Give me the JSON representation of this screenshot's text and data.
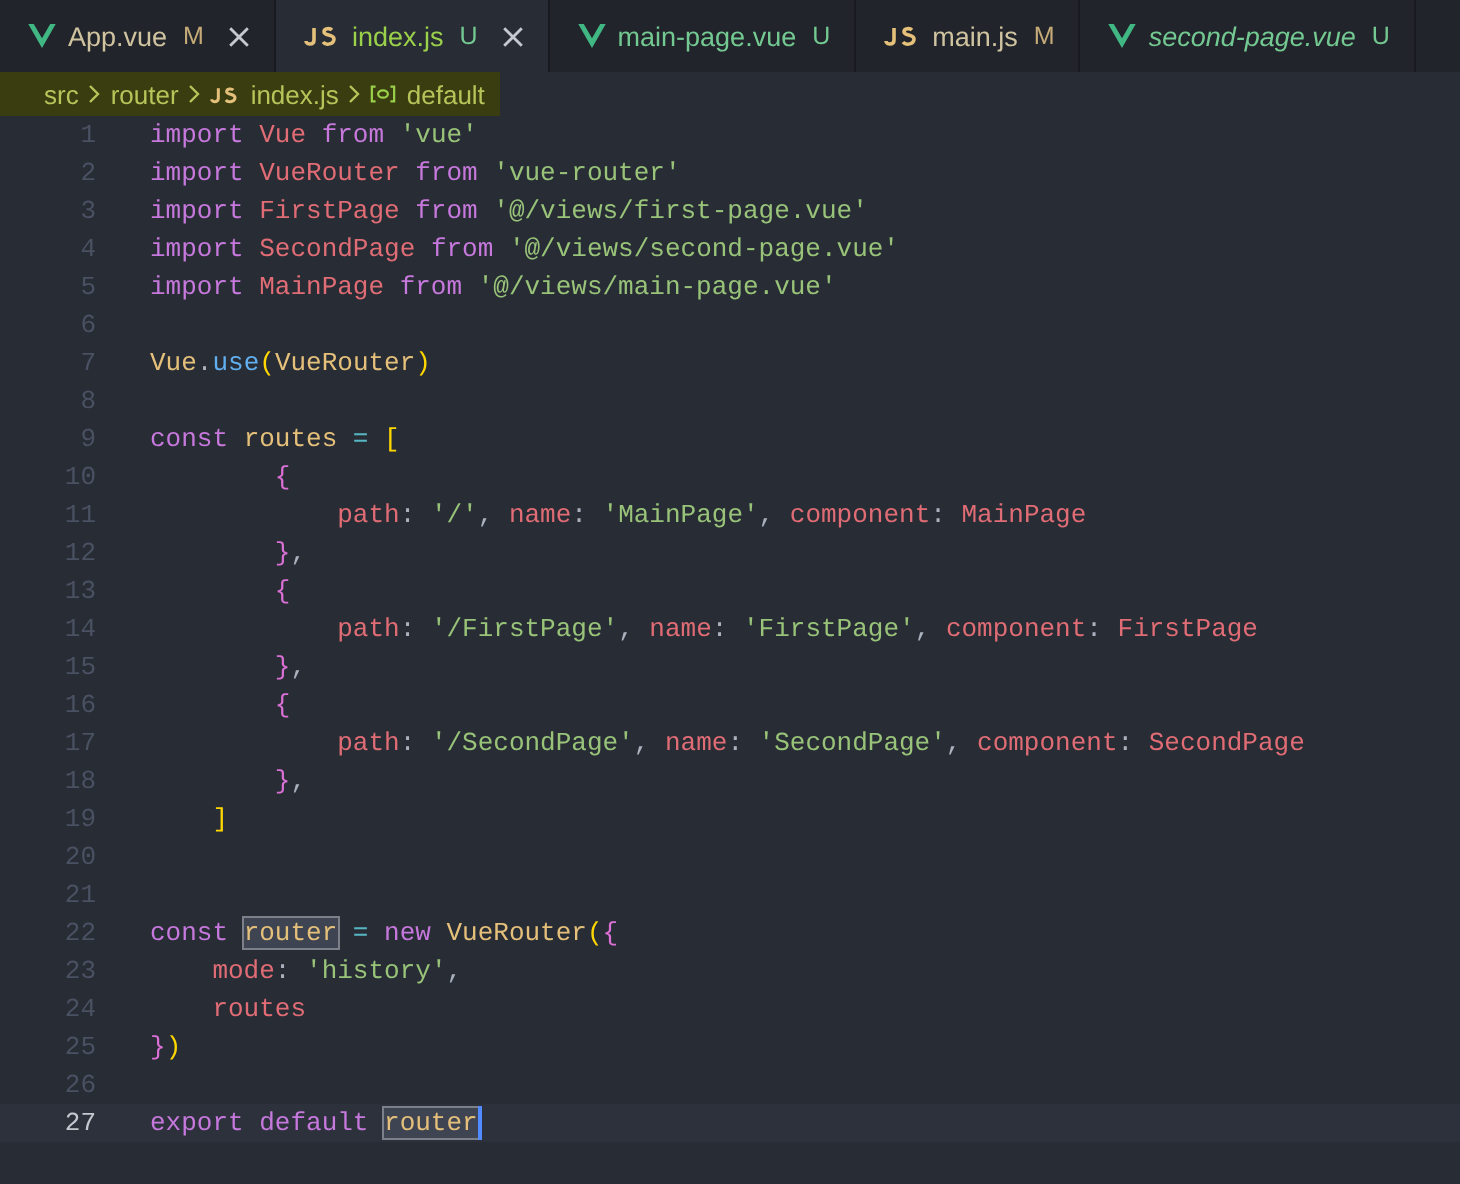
{
  "tabs": [
    {
      "label": "App.vue",
      "kind": "vue",
      "status": "M",
      "selected": false,
      "preview": false,
      "closable": true
    },
    {
      "label": "index.js",
      "kind": "js",
      "status": "U",
      "selected": true,
      "preview": false,
      "closable": true
    },
    {
      "label": "main-page.vue",
      "kind": "vue",
      "status": "U",
      "selected": false,
      "preview": false,
      "closable": false
    },
    {
      "label": "main.js",
      "kind": "js",
      "status": "M",
      "selected": false,
      "preview": false,
      "closable": false
    },
    {
      "label": "second-page.vue",
      "kind": "vue",
      "status": "U",
      "selected": false,
      "preview": true,
      "closable": false
    }
  ],
  "breadcrumb": [
    {
      "label": "src",
      "kind": "folder"
    },
    {
      "label": "router",
      "kind": "folder"
    },
    {
      "label": "index.js",
      "kind": "js"
    },
    {
      "label": "default",
      "kind": "symbol"
    }
  ],
  "editor": {
    "lines": [
      {
        "number": "1",
        "tokens": [
          {
            "kind": "kw",
            "text": "import "
          },
          {
            "kind": "id",
            "text": "Vue "
          },
          {
            "kind": "kw",
            "text": "from "
          },
          {
            "kind": "str",
            "text": "'vue'"
          }
        ]
      },
      {
        "number": "2",
        "tokens": [
          {
            "kind": "kw",
            "text": "import "
          },
          {
            "kind": "id",
            "text": "VueRouter "
          },
          {
            "kind": "kw",
            "text": "from "
          },
          {
            "kind": "str",
            "text": "'vue-router'"
          }
        ]
      },
      {
        "number": "3",
        "tokens": [
          {
            "kind": "kw",
            "text": "import "
          },
          {
            "kind": "id",
            "text": "FirstPage "
          },
          {
            "kind": "kw",
            "text": "from "
          },
          {
            "kind": "str",
            "text": "'@/views/first-page.vue'"
          }
        ]
      },
      {
        "number": "4",
        "tokens": [
          {
            "kind": "kw",
            "text": "import "
          },
          {
            "kind": "id",
            "text": "SecondPage "
          },
          {
            "kind": "kw",
            "text": "from "
          },
          {
            "kind": "str",
            "text": "'@/views/second-page.vue'"
          }
        ]
      },
      {
        "number": "5",
        "tokens": [
          {
            "kind": "kw",
            "text": "import "
          },
          {
            "kind": "id",
            "text": "MainPage "
          },
          {
            "kind": "kw",
            "text": "from "
          },
          {
            "kind": "str",
            "text": "'@/views/main-page.vue'"
          }
        ]
      },
      {
        "number": "6"
      },
      {
        "number": "7",
        "tokens": [
          {
            "kind": "type",
            "text": "Vue"
          },
          {
            "kind": "plain",
            "text": "."
          },
          {
            "kind": "fn",
            "text": "use"
          },
          {
            "kind": "br1",
            "text": "("
          },
          {
            "kind": "type",
            "text": "VueRouter"
          },
          {
            "kind": "br1",
            "text": ")"
          }
        ]
      },
      {
        "number": "8"
      },
      {
        "number": "9",
        "tokens": [
          {
            "kind": "kw",
            "text": "const "
          },
          {
            "kind": "type",
            "text": "routes "
          },
          {
            "kind": "op",
            "text": "= "
          },
          {
            "kind": "br1",
            "text": "["
          }
        ]
      },
      {
        "number": "10",
        "tokens": [
          {
            "kind": "br2",
            "text": "        {"
          }
        ]
      },
      {
        "number": "11",
        "tokens": [
          {
            "kind": "id",
            "text": "            path"
          },
          {
            "kind": "plain",
            "text": ": "
          },
          {
            "kind": "str",
            "text": "'/'"
          },
          {
            "kind": "plain",
            "text": ", "
          },
          {
            "kind": "id",
            "text": "name"
          },
          {
            "kind": "plain",
            "text": ": "
          },
          {
            "kind": "str",
            "text": "'MainPage'"
          },
          {
            "kind": "plain",
            "text": ", "
          },
          {
            "kind": "id",
            "text": "component"
          },
          {
            "kind": "plain",
            "text": ": "
          },
          {
            "kind": "id",
            "text": "MainPage"
          }
        ]
      },
      {
        "number": "12",
        "tokens": [
          {
            "kind": "br2",
            "text": "        }"
          },
          {
            "kind": "plain",
            "text": ","
          }
        ]
      },
      {
        "number": "13",
        "tokens": [
          {
            "kind": "br2",
            "text": "        {"
          }
        ]
      },
      {
        "number": "14",
        "tokens": [
          {
            "kind": "id",
            "text": "            path"
          },
          {
            "kind": "plain",
            "text": ": "
          },
          {
            "kind": "str",
            "text": "'/FirstPage'"
          },
          {
            "kind": "plain",
            "text": ", "
          },
          {
            "kind": "id",
            "text": "name"
          },
          {
            "kind": "plain",
            "text": ": "
          },
          {
            "kind": "str",
            "text": "'FirstPage'"
          },
          {
            "kind": "plain",
            "text": ", "
          },
          {
            "kind": "id",
            "text": "component"
          },
          {
            "kind": "plain",
            "text": ": "
          },
          {
            "kind": "id",
            "text": "FirstPage"
          }
        ]
      },
      {
        "number": "15",
        "tokens": [
          {
            "kind": "br2",
            "text": "        }"
          },
          {
            "kind": "plain",
            "text": ","
          }
        ]
      },
      {
        "number": "16",
        "tokens": [
          {
            "kind": "br2",
            "text": "        {"
          }
        ]
      },
      {
        "number": "17",
        "tokens": [
          {
            "kind": "id",
            "text": "            path"
          },
          {
            "kind": "plain",
            "text": ": "
          },
          {
            "kind": "str",
            "text": "'/SecondPage'"
          },
          {
            "kind": "plain",
            "text": ", "
          },
          {
            "kind": "id",
            "text": "name"
          },
          {
            "kind": "plain",
            "text": ": "
          },
          {
            "kind": "str",
            "text": "'SecondPage'"
          },
          {
            "kind": "plain",
            "text": ", "
          },
          {
            "kind": "id",
            "text": "component"
          },
          {
            "kind": "plain",
            "text": ": "
          },
          {
            "kind": "id",
            "text": "SecondPage"
          }
        ]
      },
      {
        "number": "18",
        "tokens": [
          {
            "kind": "br2",
            "text": "        }"
          },
          {
            "kind": "plain",
            "text": ","
          }
        ]
      },
      {
        "number": "19",
        "tokens": [
          {
            "kind": "br1",
            "text": "    ]"
          }
        ]
      },
      {
        "number": "20"
      },
      {
        "number": "21"
      },
      {
        "number": "22",
        "tokens": [
          {
            "kind": "kw",
            "text": "const "
          },
          {
            "kind": "sel",
            "text": "router"
          },
          {
            "kind": "op",
            "text": " = "
          },
          {
            "kind": "kw",
            "text": "new "
          },
          {
            "kind": "type",
            "text": "VueRouter"
          },
          {
            "kind": "br1",
            "text": "("
          },
          {
            "kind": "br2",
            "text": "{"
          }
        ]
      },
      {
        "number": "23",
        "tokens": [
          {
            "kind": "id",
            "text": "    mode"
          },
          {
            "kind": "plain",
            "text": ": "
          },
          {
            "kind": "str",
            "text": "'history'"
          },
          {
            "kind": "plain",
            "text": ","
          }
        ]
      },
      {
        "number": "24",
        "tokens": [
          {
            "kind": "id",
            "text": "    routes"
          }
        ]
      },
      {
        "number": "25",
        "tokens": [
          {
            "kind": "br2",
            "text": "}"
          },
          {
            "kind": "br1",
            "text": ")"
          }
        ]
      },
      {
        "number": "26"
      },
      {
        "number": "27",
        "current": true,
        "tokens": [
          {
            "kind": "kw",
            "text": "export "
          },
          {
            "kind": "kw",
            "text": "default "
          },
          {
            "kind": "sel",
            "text": "router"
          }
        ]
      }
    ]
  }
}
